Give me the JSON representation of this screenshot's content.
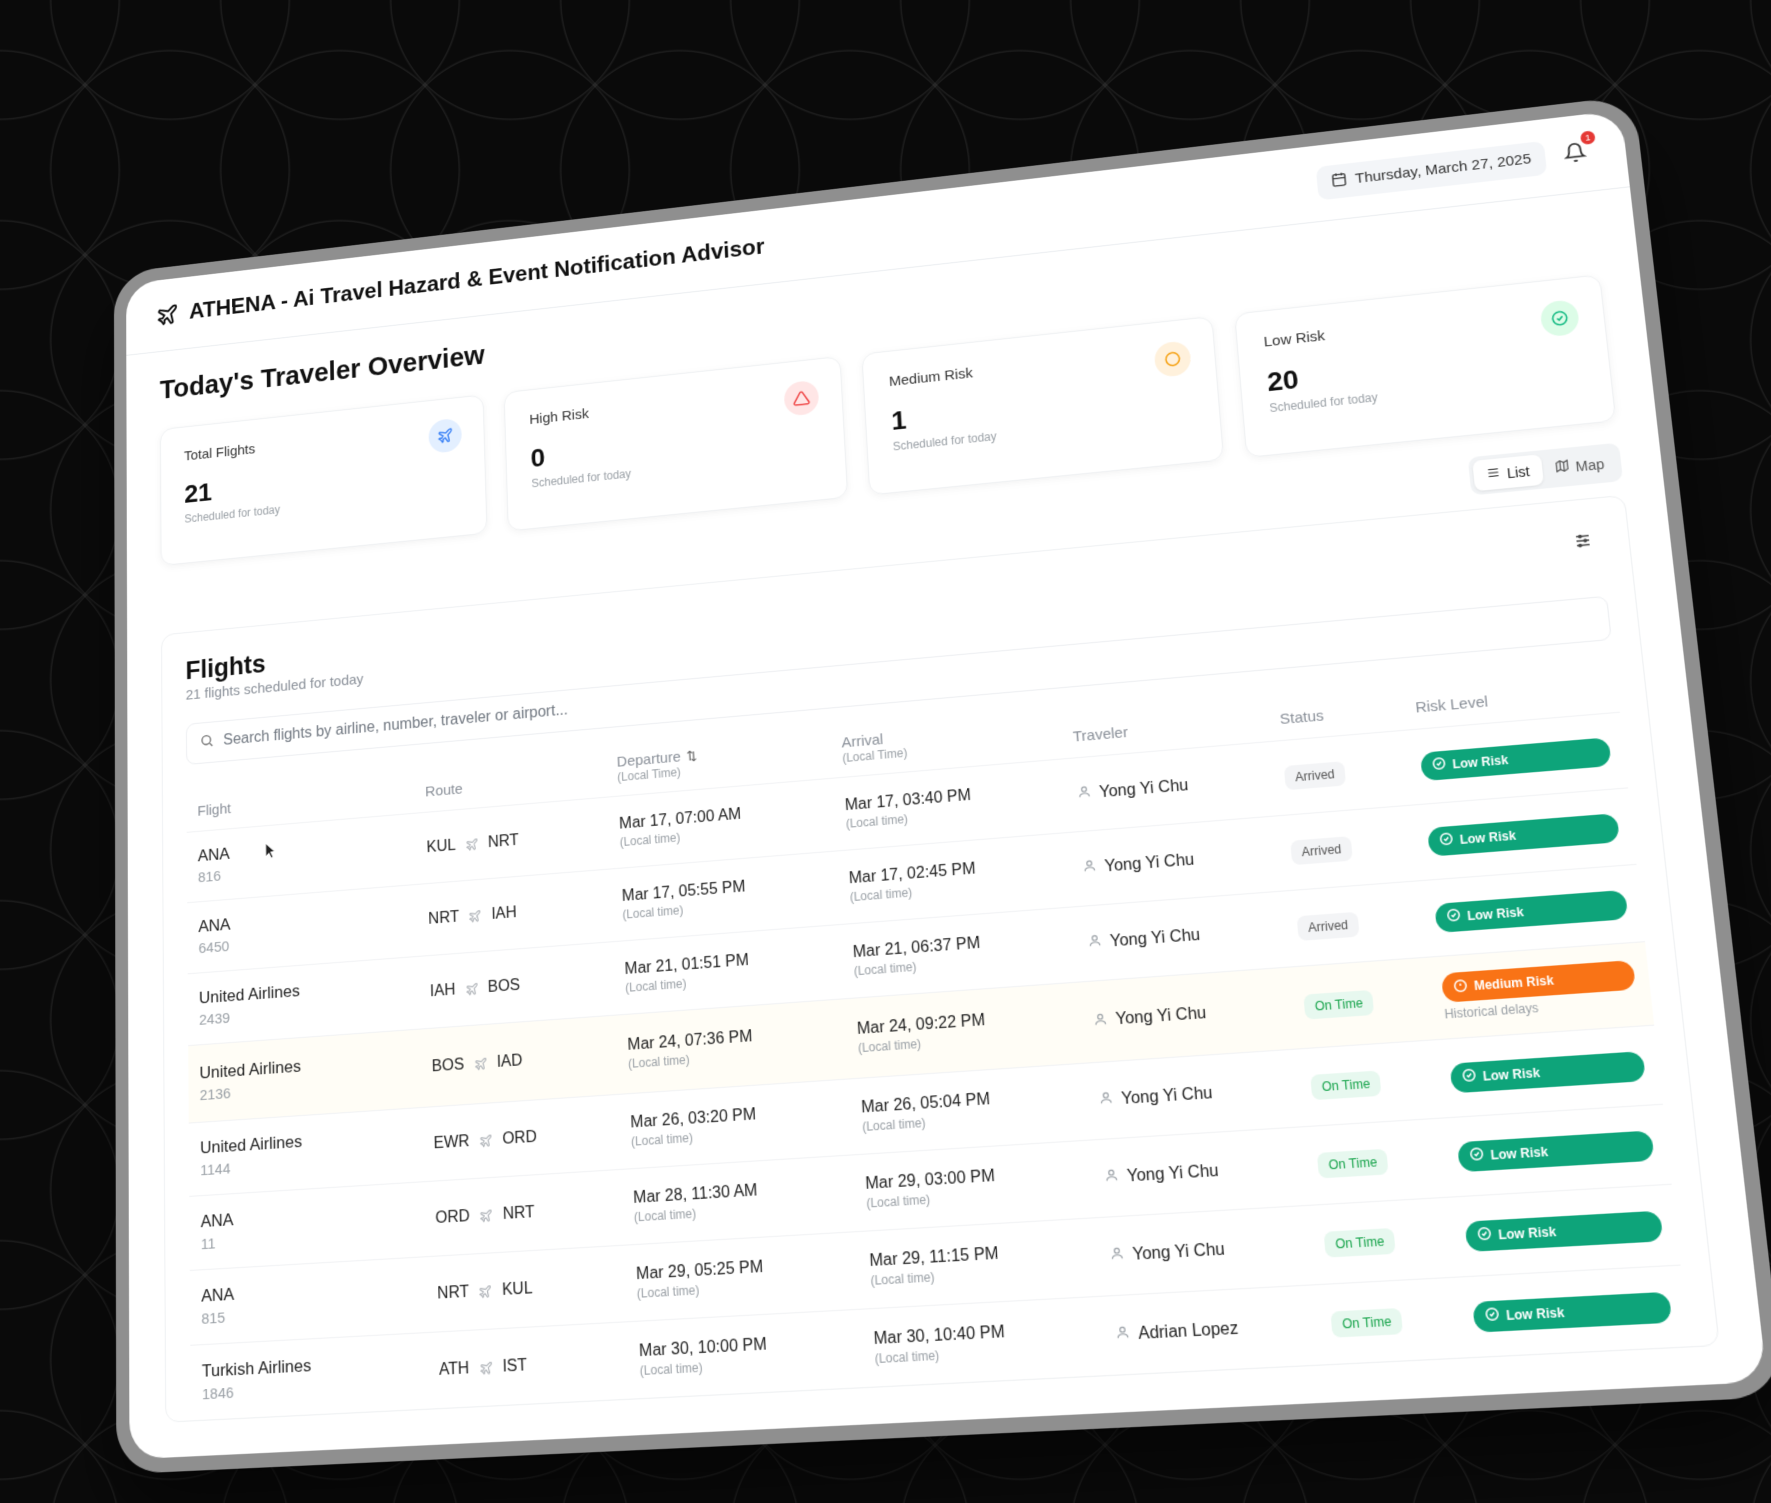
{
  "app": {
    "title": "ATHENA - Ai Travel Hazard & Event Notification Advisor",
    "date": "Thursday, March 27, 2025",
    "notification_count": "1",
    "brand_icon": "plane-icon"
  },
  "overview": {
    "title": "Today's Traveler Overview",
    "cards": [
      {
        "label": "Total Flights",
        "value": "21",
        "sub": "Scheduled for today",
        "icon": "plane-icon",
        "color": "#3b82f6"
      },
      {
        "label": "High Risk",
        "value": "0",
        "sub": "Scheduled for today",
        "icon": "alert-triangle-icon",
        "color": "#ef4444"
      },
      {
        "label": "Medium Risk",
        "value": "1",
        "sub": "Scheduled for today",
        "icon": "alert-circle-icon",
        "color": "#f59e0b"
      },
      {
        "label": "Low Risk",
        "value": "20",
        "sub": "Scheduled for today",
        "icon": "check-circle-icon",
        "color": "#10b981"
      }
    ]
  },
  "view_toggle": {
    "list": "List",
    "map": "Map"
  },
  "flights": {
    "title": "Flights",
    "subtitle": "21 flights scheduled for today",
    "search_placeholder": "Search flights by airline, number, traveler or airport...",
    "columns": {
      "flight": "Flight",
      "route": "Route",
      "departure": "Departure",
      "departure_sub": "(Local Time)",
      "arrival": "Arrival",
      "arrival_sub": "(Local Time)",
      "traveler": "Traveler",
      "status": "Status",
      "risk": "Risk Level"
    },
    "rows": [
      {
        "airline": "ANA",
        "number": "816",
        "from": "KUL",
        "to": "NRT",
        "dep": "Mar 17, 07:00 AM",
        "dep_sub": "(Local time)",
        "arr": "Mar 17, 03:40 PM",
        "arr_sub": "(Local time)",
        "traveler": "Yong Yi Chu",
        "status": "Arrived",
        "risk": "Low Risk",
        "risk_note": ""
      },
      {
        "airline": "ANA",
        "number": "6450",
        "from": "NRT",
        "to": "IAH",
        "dep": "Mar 17, 05:55 PM",
        "dep_sub": "(Local time)",
        "arr": "Mar 17, 02:45 PM",
        "arr_sub": "(Local time)",
        "traveler": "Yong Yi Chu",
        "status": "Arrived",
        "risk": "Low Risk",
        "risk_note": ""
      },
      {
        "airline": "United Airlines",
        "number": "2439",
        "from": "IAH",
        "to": "BOS",
        "dep": "Mar 21, 01:51 PM",
        "dep_sub": "(Local time)",
        "arr": "Mar 21, 06:37 PM",
        "arr_sub": "(Local time)",
        "traveler": "Yong Yi Chu",
        "status": "Arrived",
        "risk": "Low Risk",
        "risk_note": ""
      },
      {
        "airline": "United Airlines",
        "number": "2136",
        "from": "BOS",
        "to": "IAD",
        "dep": "Mar 24, 07:36 PM",
        "dep_sub": "(Local time)",
        "arr": "Mar 24, 09:22 PM",
        "arr_sub": "(Local time)",
        "traveler": "Yong Yi Chu",
        "status": "On Time",
        "risk": "Medium Risk",
        "risk_note": "Historical delays"
      },
      {
        "airline": "United Airlines",
        "number": "1144",
        "from": "EWR",
        "to": "ORD",
        "dep": "Mar 26, 03:20 PM",
        "dep_sub": "(Local time)",
        "arr": "Mar 26, 05:04 PM",
        "arr_sub": "(Local time)",
        "traveler": "Yong Yi Chu",
        "status": "On Time",
        "risk": "Low Risk",
        "risk_note": ""
      },
      {
        "airline": "ANA",
        "number": "11",
        "from": "ORD",
        "to": "NRT",
        "dep": "Mar 28, 11:30 AM",
        "dep_sub": "(Local time)",
        "arr": "Mar 29, 03:00 PM",
        "arr_sub": "(Local time)",
        "traveler": "Yong Yi Chu",
        "status": "On Time",
        "risk": "Low Risk",
        "risk_note": ""
      },
      {
        "airline": "ANA",
        "number": "815",
        "from": "NRT",
        "to": "KUL",
        "dep": "Mar 29, 05:25 PM",
        "dep_sub": "(Local time)",
        "arr": "Mar 29, 11:15 PM",
        "arr_sub": "(Local time)",
        "traveler": "Yong Yi Chu",
        "status": "On Time",
        "risk": "Low Risk",
        "risk_note": ""
      },
      {
        "airline": "Turkish Airlines",
        "number": "1846",
        "from": "ATH",
        "to": "IST",
        "dep": "Mar 30, 10:00 PM",
        "dep_sub": "(Local time)",
        "arr": "Mar 30, 10:40 PM",
        "arr_sub": "(Local time)",
        "traveler": "Adrian Lopez",
        "status": "On Time",
        "risk": "Low Risk",
        "risk_note": ""
      }
    ]
  }
}
